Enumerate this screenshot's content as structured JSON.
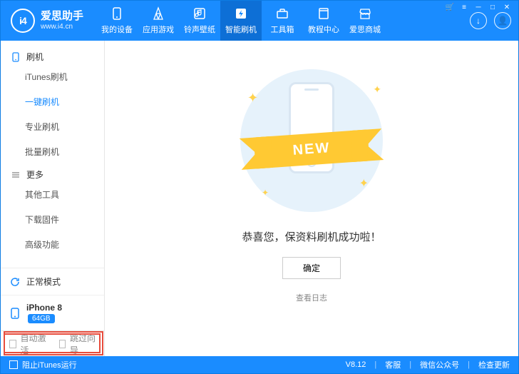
{
  "brand": {
    "name": "爱思助手",
    "url": "www.i4.cn",
    "logo_text": "i4"
  },
  "window_controls": {
    "cart": "🛒",
    "menu": "≡",
    "min": "─",
    "max": "□",
    "close": "✕"
  },
  "title_side": {
    "download": "↓",
    "user": "👤"
  },
  "nav": [
    {
      "label": "我的设备",
      "icon": "device"
    },
    {
      "label": "应用游戏",
      "icon": "apps"
    },
    {
      "label": "铃声壁纸",
      "icon": "music"
    },
    {
      "label": "智能刷机",
      "icon": "flash",
      "active": true
    },
    {
      "label": "工具箱",
      "icon": "toolbox"
    },
    {
      "label": "教程中心",
      "icon": "book"
    },
    {
      "label": "爱思商城",
      "icon": "store"
    }
  ],
  "sidebar": {
    "groups": [
      {
        "title": "刷机",
        "items": [
          {
            "label": "iTunes刷机"
          },
          {
            "label": "一键刷机",
            "active": true
          },
          {
            "label": "专业刷机"
          },
          {
            "label": "批量刷机"
          }
        ]
      },
      {
        "title": "更多",
        "items": [
          {
            "label": "其他工具"
          },
          {
            "label": "下载固件"
          },
          {
            "label": "高级功能"
          }
        ]
      }
    ],
    "mode": {
      "label": "正常模式"
    },
    "device": {
      "name": "iPhone 8",
      "storage": "64GB"
    }
  },
  "main": {
    "ribbon": "NEW",
    "success": "恭喜您，保资料刷机成功啦！",
    "confirm": "确定",
    "view_log": "查看日志"
  },
  "footer": {
    "auto_activate": "自动激活",
    "skip_wizard": "跳过向导",
    "block_itunes": "阻止iTunes运行"
  },
  "status": {
    "version": "V8.12",
    "support": "客服",
    "wechat": "微信公众号",
    "update": "检查更新"
  }
}
